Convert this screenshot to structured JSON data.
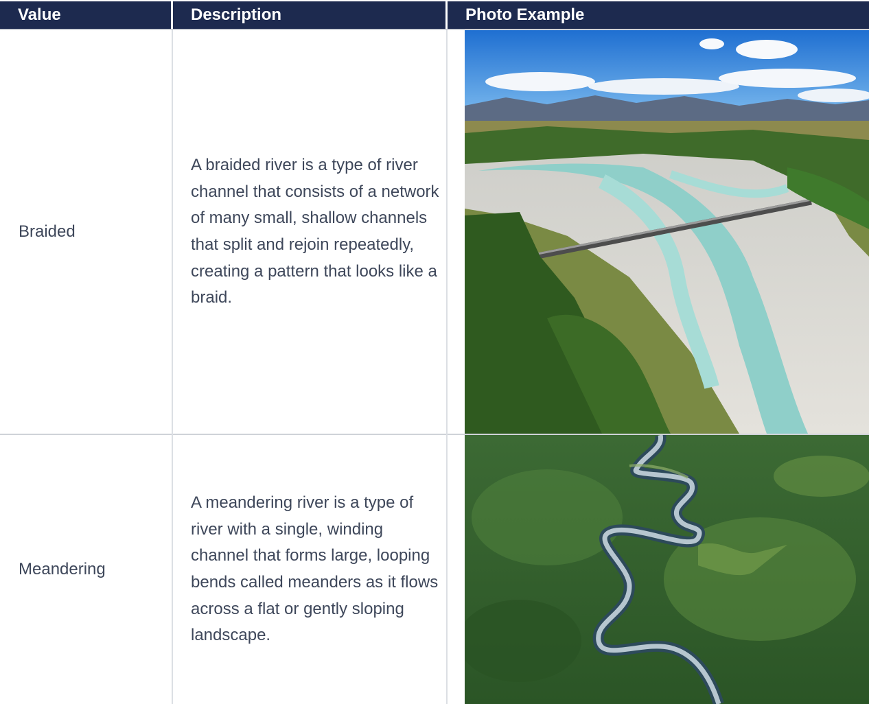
{
  "table": {
    "headers": [
      "Value",
      "Description",
      "Photo Example"
    ],
    "rows": [
      {
        "value": "Braided",
        "description": "A braided river is a type of river channel that consists of a network of many small, shallow channels that split and rejoin repeatedly, creating a pattern that looks like a braid.",
        "photo": "aerial-braided-river-photo"
      },
      {
        "value": "Meandering",
        "description": "A meandering river is a type of river with a single, winding channel that forms large, looping bends called meanders as it flows across a flat or gently sloping landscape.",
        "photo": "aerial-meandering-river-photo"
      }
    ]
  },
  "colors": {
    "header_bg": "#1d2a4f",
    "header_text": "#ffffff",
    "body_text": "#3e475a",
    "grid": "#cfd2d8"
  }
}
